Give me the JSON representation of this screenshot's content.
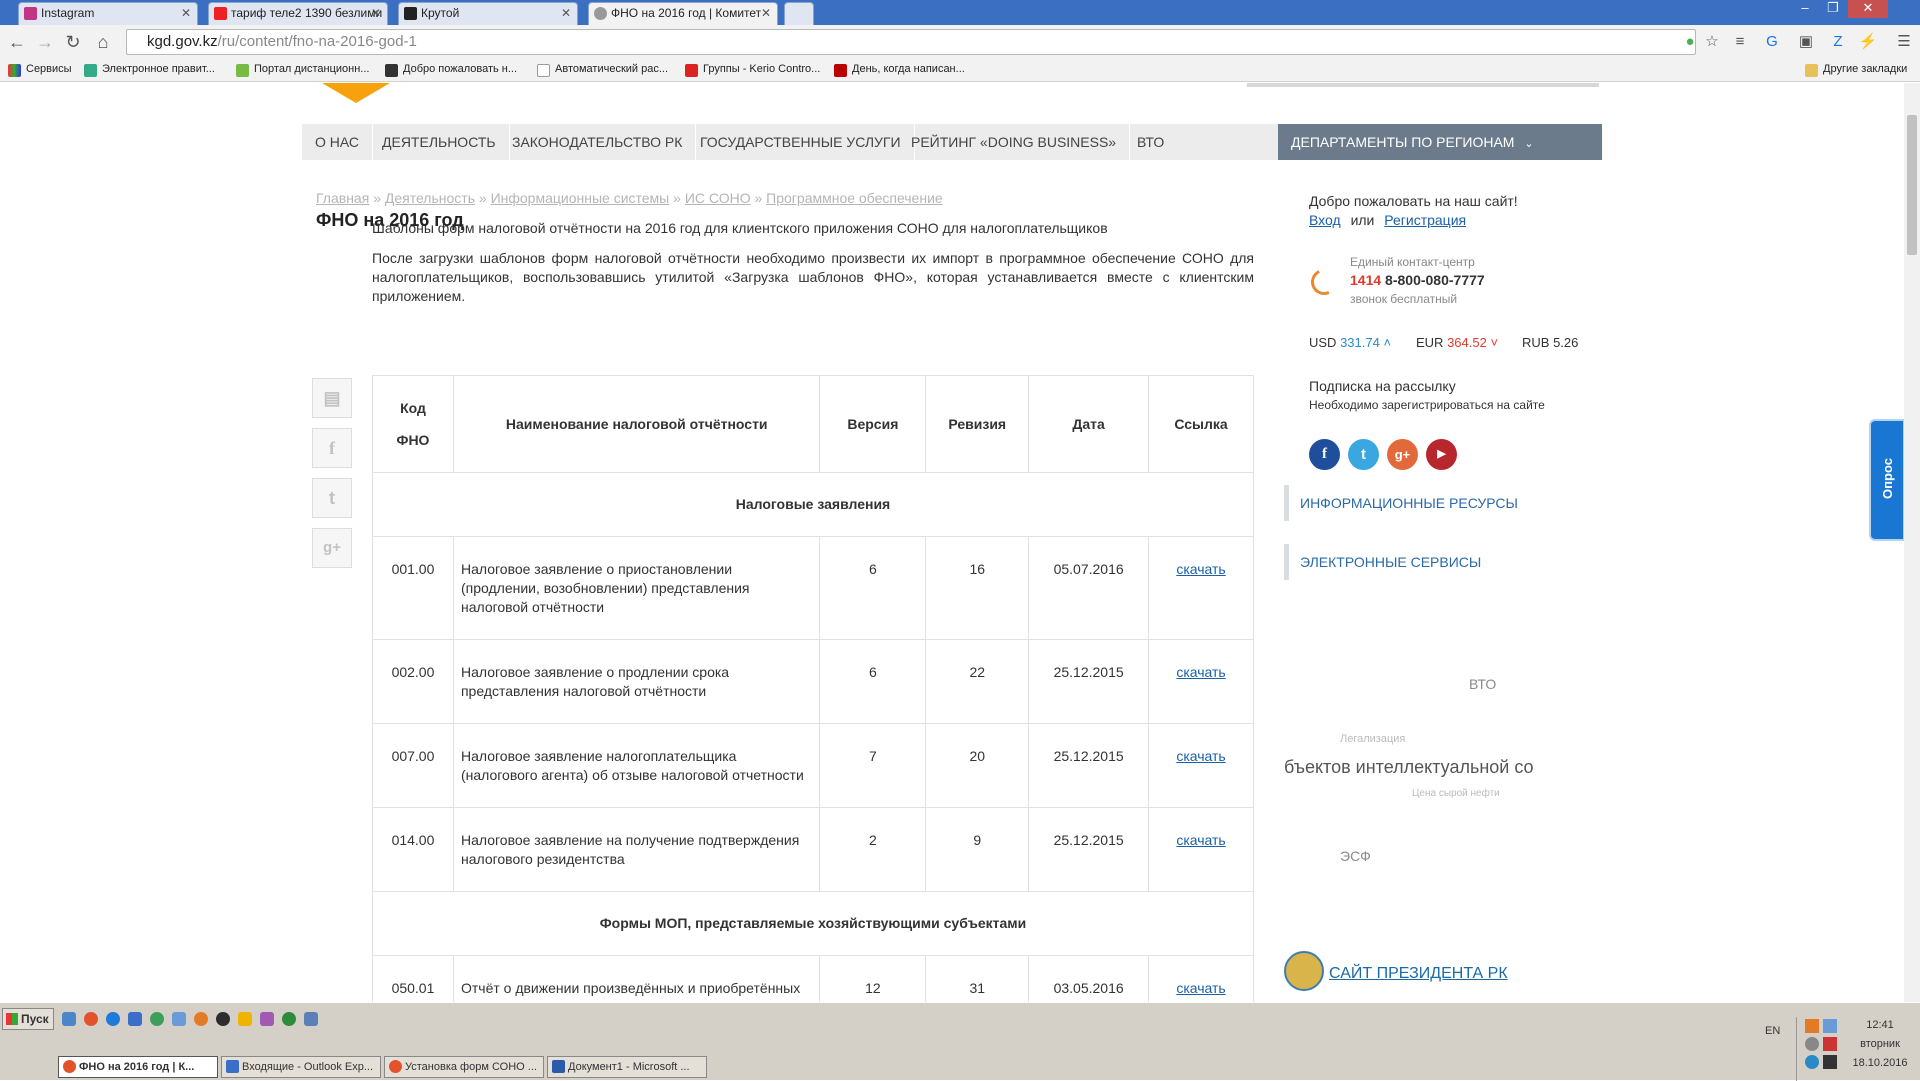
{
  "browser": {
    "tabs": [
      {
        "title": "Instagram"
      },
      {
        "title": "тариф теле2 1390 безлими"
      },
      {
        "title": "Крутой"
      },
      {
        "title": "ФНО на 2016 год | Комитет"
      }
    ],
    "url_domain": "kgd.gov.kz",
    "url_path": "/ru/content/fno-na-2016-god-1",
    "bookmarks": [
      {
        "label": "Сервисы"
      },
      {
        "label": "Электронное правит..."
      },
      {
        "label": "Портал дистанционн..."
      },
      {
        "label": "Добро пожаловать н..."
      },
      {
        "label": "Автоматический рас..."
      },
      {
        "label": "Группы - Kerio Contro..."
      },
      {
        "label": "День, когда написан..."
      }
    ],
    "other_bookmarks": "Другие закладки"
  },
  "nav": {
    "items": [
      {
        "label": "О НАС"
      },
      {
        "label": "ДЕЯТЕЛЬНОСТЬ"
      },
      {
        "label": "ЗАКОНОДАТЕЛЬСТВО РК"
      },
      {
        "label": "ГОСУДАРСТВЕННЫЕ УСЛУГИ"
      },
      {
        "label": "РЕЙТИНГ «DOING BUSINESS»"
      },
      {
        "label": "ВТО"
      }
    ],
    "departments": "ДЕПАРТАМЕНТЫ ПО РЕГИОНАМ"
  },
  "breadcrumb": {
    "items": [
      "Главная",
      "Деятельность",
      "Информационные системы",
      "ИС СОНО",
      "Программное обеспечение"
    ],
    "sep": "»"
  },
  "page": {
    "title": "ФНО на 2016 год",
    "intro1": "Шаблоны форм налоговой отчётности на 2016 год для клиентского приложения СОНО для налогоплательщиков",
    "intro2": "После загрузки шаблонов форм налоговой отчётности необходимо произвести их импорт в программное обеспечение СОНО для налогоплательщиков, воспользовавшись утилитой «Загрузка шаблонов ФНО», которая устанавливается вместе с клиентским приложением."
  },
  "table": {
    "headers": {
      "code": "Код ФНО",
      "name": "Наименование налоговой отчётности",
      "version": "Версия",
      "revision": "Ревизия",
      "date": "Дата",
      "link": "Ссылка"
    },
    "section1": "Налоговые заявления",
    "section2": "Формы МОП, представляемые хозяйствующими субъектами",
    "rows": [
      {
        "code": "001.00",
        "name": "Налоговое заявление о приостановлении (продлении, возобновлении) представления налоговой отчётности",
        "version": "6",
        "revision": "16",
        "date": "05.07.2016",
        "link": "скачать"
      },
      {
        "code": "002.00",
        "name": "Налоговое заявление о продлении срока представления налоговой отчётности",
        "version": "6",
        "revision": "22",
        "date": "25.12.2015",
        "link": "скачать"
      },
      {
        "code": "007.00",
        "name": "Налоговое заявление налогоплательщика (налогового агента) об отзыве налоговой отчетности",
        "version": "7",
        "revision": "20",
        "date": "25.12.2015",
        "link": "скачать"
      },
      {
        "code": "014.00",
        "name": "Налоговое заявление на получение подтверждения налогового резидентства",
        "version": "2",
        "revision": "9",
        "date": "25.12.2015",
        "link": "скачать"
      }
    ],
    "row5": {
      "code": "050.01",
      "name": "Отчёт о движении произведённых и приобретённых",
      "version": "12",
      "revision": "31",
      "date": "03.05.2016",
      "link": "скачать"
    }
  },
  "sidebar": {
    "welcome": "Добро пожаловать на наш сайт!",
    "login": "Вход",
    "or": "или",
    "register": "Регистрация",
    "contact_label": "Единый контакт-центр",
    "contact_short": "1414",
    "contact_phone": "8-800-080-7777",
    "contact_free": "звонок бесплатный",
    "currency": [
      {
        "code": "USD",
        "value": "331.74",
        "trend": "˄"
      },
      {
        "code": "EUR",
        "value": "364.52",
        "trend": "˅"
      },
      {
        "code": "RUB",
        "value": "5.26",
        "trend": ""
      }
    ],
    "subscribe_title": "Подписка на рассылку",
    "subscribe_note": "Необходимо зарегистрироваться на сайте",
    "info_resources": "ИНФОРМАЦИОННЫЕ РЕСУРСЫ",
    "e_services": "ЭЛЕКТРОННЫЕ СЕРВИСЫ",
    "banner_wto": "ВТО",
    "banner_legal": "Легализация",
    "banner_ip": "бъектов интеллектуальной со",
    "banner_oil": "Цена сырой нефти",
    "banner_esf": "ЭСФ",
    "president_site": "САЙТ ПРЕЗИДЕНТА РК",
    "poll": "Опрос"
  },
  "taskbar": {
    "start": "Пуск",
    "items": [
      {
        "label": "ФНО на 2016 год | К..."
      },
      {
        "label": "Входящие - Outlook Exp..."
      },
      {
        "label": "Установка форм СОНО ..."
      },
      {
        "label": "Документ1 - Microsoft ..."
      }
    ],
    "lang": "EN",
    "time": "12:41",
    "weekday": "вторник",
    "date": "18.10.2016"
  }
}
